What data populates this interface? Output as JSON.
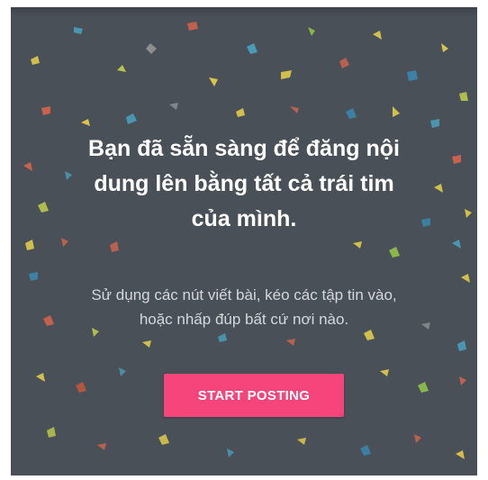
{
  "dialog": {
    "headline_lines": [
      "Bạn đã sẵn sàng để đăng nội",
      "dung lên bằng tất cả trái tim",
      "của mình."
    ],
    "subtext_lines": [
      "Sử dụng các nút viết bài, kéo các tập tin vào,",
      "hoặc nhấp đúp bất cứ nơi nào."
    ],
    "cta_label": "START POSTING"
  },
  "colors": {
    "background": "#4a5058",
    "accent": "#f5457a",
    "confetti": [
      "#e8d24a",
      "#c8d84a",
      "#4aa8c8",
      "#3a8fb8",
      "#e8664a",
      "#d45a3a",
      "#9ad04a",
      "#a8a8a8"
    ]
  }
}
